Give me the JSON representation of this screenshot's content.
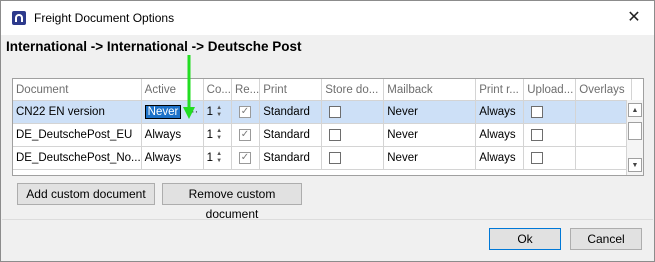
{
  "window": {
    "title": "Freight Document Options",
    "close": "✕"
  },
  "route": "International -> International -> Deutsche Post",
  "grid": {
    "columns": [
      "Document",
      "Active",
      "Co...",
      "Re...",
      "Print",
      "Store do...",
      "Mailback",
      "Print r...",
      "Upload...",
      "Overlays"
    ],
    "rows": [
      {
        "document": "CN22 EN version",
        "active": "Never",
        "copies": "1",
        "required": true,
        "print": "Standard",
        "store": false,
        "mailback": "Never",
        "print_r": "Always",
        "upload": false,
        "overlays": ""
      },
      {
        "document": "DE_DeutschePost_EU",
        "active": "Always",
        "copies": "1",
        "required": true,
        "print": "Standard",
        "store": false,
        "mailback": "Never",
        "print_r": "Always",
        "upload": false,
        "overlays": ""
      },
      {
        "document": "DE_DeutschePost_No...",
        "active": "Always",
        "copies": "1",
        "required": true,
        "print": "Standard",
        "store": false,
        "mailback": "Never",
        "print_r": "Always",
        "upload": false,
        "overlays": ""
      }
    ],
    "ellipsis": "···"
  },
  "buttons": {
    "add": "Add custom document",
    "remove": "Remove custom document",
    "ok": "Ok",
    "cancel": "Cancel"
  },
  "colors": {
    "selection": "#cde0f7",
    "edit_highlight": "#1d72c8",
    "annotation_arrow": "#22dd22"
  }
}
